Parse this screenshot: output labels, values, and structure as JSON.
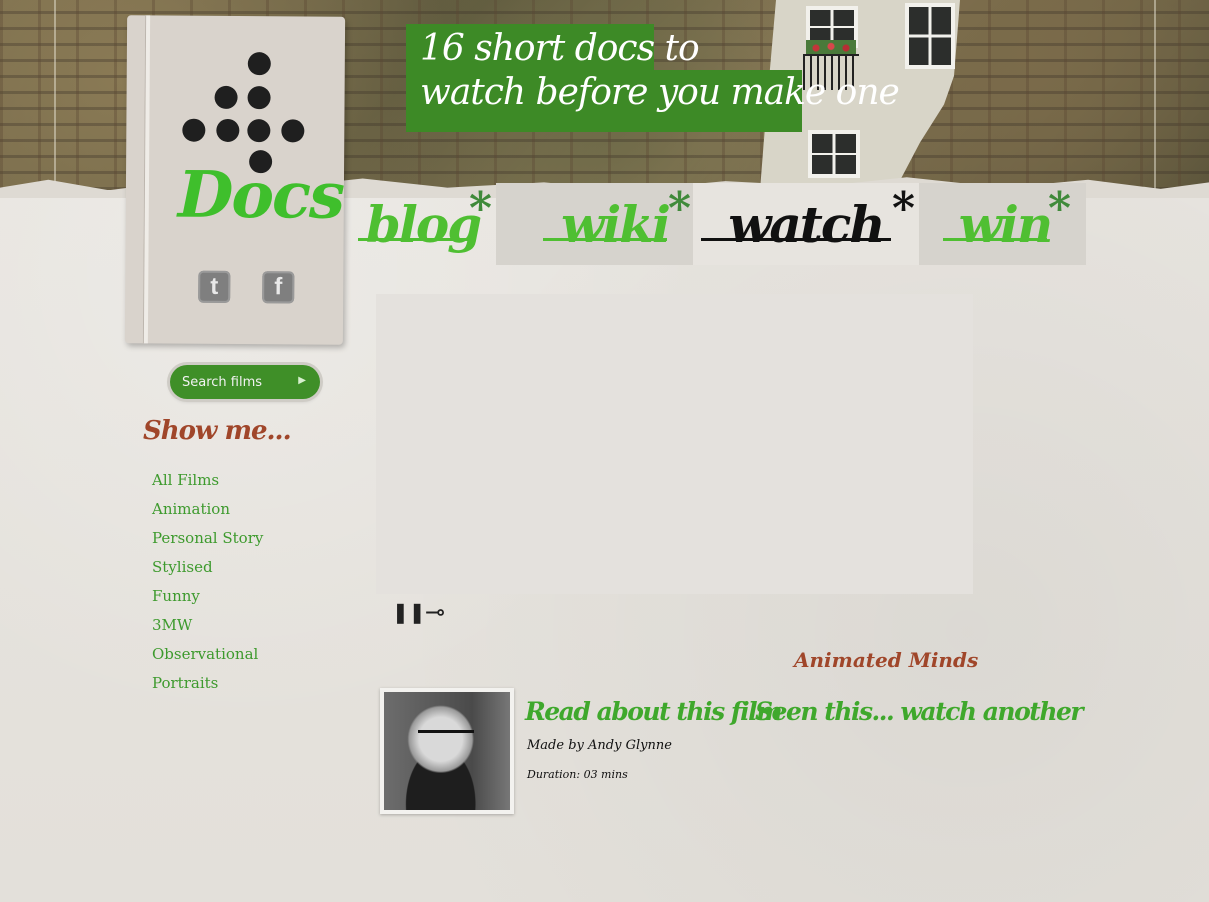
{
  "header": {
    "headline_line1": "16 short docs to",
    "headline_line2": "watch before you make one"
  },
  "logo": {
    "wordmark": "Docs",
    "social": [
      {
        "name": "twitter",
        "glyph": "t"
      },
      {
        "name": "facebook",
        "glyph": "f"
      }
    ]
  },
  "nav": {
    "tabs": [
      {
        "label": "blog",
        "active": false
      },
      {
        "label": "wiki",
        "active": false
      },
      {
        "label": "watch",
        "active": true
      },
      {
        "label": "win",
        "active": false
      }
    ],
    "star": "*"
  },
  "sidebar": {
    "search_label": "Search films",
    "search_arrow": "▶",
    "show_me": "Show me...",
    "filters": [
      "All Films",
      "Animation",
      "Personal Story",
      "Stylised",
      "Funny",
      "3MW",
      "Observational",
      "Portraits"
    ]
  },
  "player": {
    "controls": [
      {
        "name": "pause-icon",
        "glyph": "❚❚"
      },
      {
        "name": "volume-icon",
        "glyph": "⊸"
      }
    ]
  },
  "film": {
    "title": "Animated Minds",
    "read_link": "Read about this film",
    "watch_link": "Seen this... watch another",
    "made_by": "Made by Andy Glynne",
    "duration": "Duration: 03 mins"
  },
  "colors": {
    "accent_green": "#3fa82c",
    "headline_green": "#3d8a26",
    "rust": "#a0462a"
  }
}
